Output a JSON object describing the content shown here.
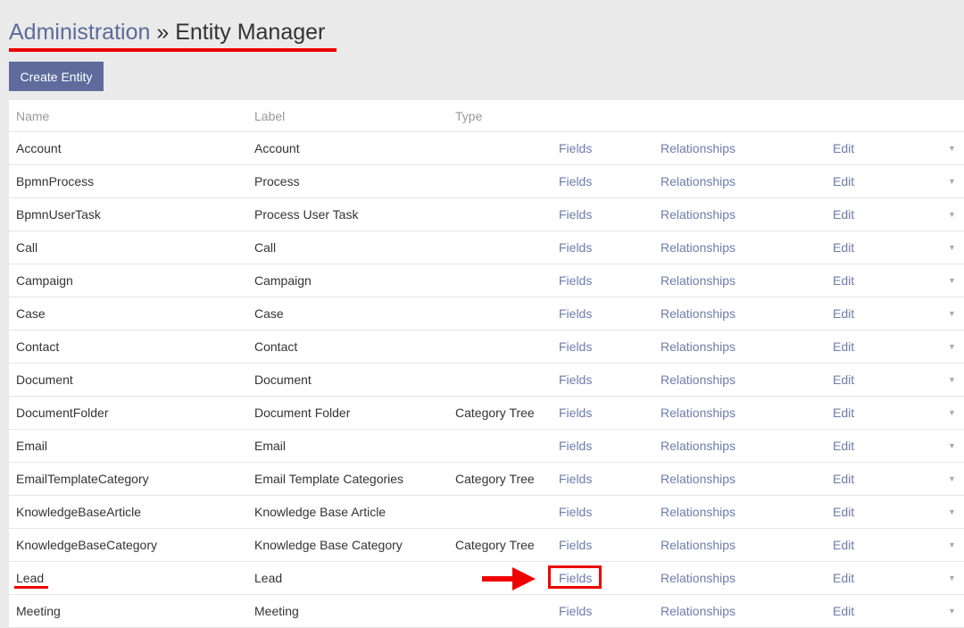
{
  "header": {
    "parent": "Administration",
    "separator": "»",
    "current": "Entity Manager"
  },
  "toolbar": {
    "create_label": "Create Entity"
  },
  "table": {
    "columns": [
      "Name",
      "Label",
      "Type"
    ],
    "action_labels": {
      "fields": "Fields",
      "relationships": "Relationships",
      "edit": "Edit",
      "caret": "▼"
    },
    "rows": [
      {
        "name": "Account",
        "label": "Account",
        "type": ""
      },
      {
        "name": "BpmnProcess",
        "label": "Process",
        "type": ""
      },
      {
        "name": "BpmnUserTask",
        "label": "Process User Task",
        "type": ""
      },
      {
        "name": "Call",
        "label": "Call",
        "type": ""
      },
      {
        "name": "Campaign",
        "label": "Campaign",
        "type": ""
      },
      {
        "name": "Case",
        "label": "Case",
        "type": ""
      },
      {
        "name": "Contact",
        "label": "Contact",
        "type": ""
      },
      {
        "name": "Document",
        "label": "Document",
        "type": ""
      },
      {
        "name": "DocumentFolder",
        "label": "Document Folder",
        "type": "Category Tree"
      },
      {
        "name": "Email",
        "label": "Email",
        "type": ""
      },
      {
        "name": "EmailTemplateCategory",
        "label": "Email Template Categories",
        "type": "Category Tree"
      },
      {
        "name": "KnowledgeBaseArticle",
        "label": "Knowledge Base Article",
        "type": ""
      },
      {
        "name": "KnowledgeBaseCategory",
        "label": "Knowledge Base Category",
        "type": "Category Tree"
      },
      {
        "name": "Lead",
        "label": "Lead",
        "type": "",
        "highlighted": true
      },
      {
        "name": "Meeting",
        "label": "Meeting",
        "type": ""
      }
    ]
  }
}
